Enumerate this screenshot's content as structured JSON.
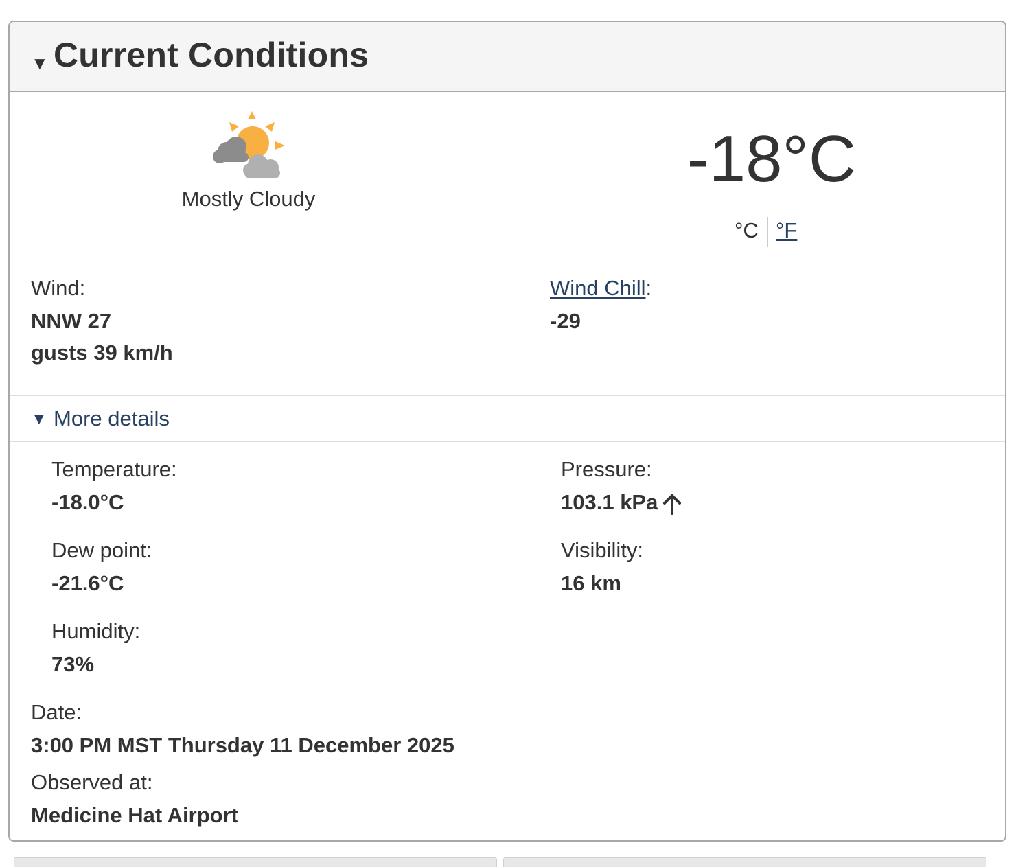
{
  "panel": {
    "title": "Current Conditions"
  },
  "summary": {
    "icon": "sun-behind-clouds-icon",
    "condition": "Mostly Cloudy",
    "temperature": "-18°C",
    "unit_celsius": "°C",
    "unit_fahrenheit": "°F"
  },
  "wind": {
    "label": "Wind:",
    "direction_speed": "NNW 27",
    "gusts": "gusts 39 km/h"
  },
  "wind_chill": {
    "label_link": "Wind Chill",
    "label_suffix": ":",
    "value": "-29"
  },
  "more_details": {
    "label": "More details",
    "expanded": true
  },
  "details": {
    "temperature": {
      "label": "Temperature:",
      "value": "-18.0°C"
    },
    "dew_point": {
      "label": "Dew point:",
      "value": "-21.6°C"
    },
    "humidity": {
      "label": "Humidity:",
      "value": "73%"
    },
    "pressure": {
      "label": "Pressure:",
      "value": "103.1 kPa",
      "trend_icon": "arrow-up-icon"
    },
    "visibility": {
      "label": "Visibility:",
      "value": "16 km"
    }
  },
  "date": {
    "label": "Date:",
    "value": "3:00 PM MST Thursday 11 December 2025"
  },
  "observed": {
    "label": "Observed at:",
    "value": "Medicine Hat Airport"
  },
  "colors": {
    "link": "#284162",
    "header_bg": "#f5f5f5",
    "border": "#a8a8a8",
    "sun": "#f8b042",
    "cloud": "#9a9a9a"
  }
}
